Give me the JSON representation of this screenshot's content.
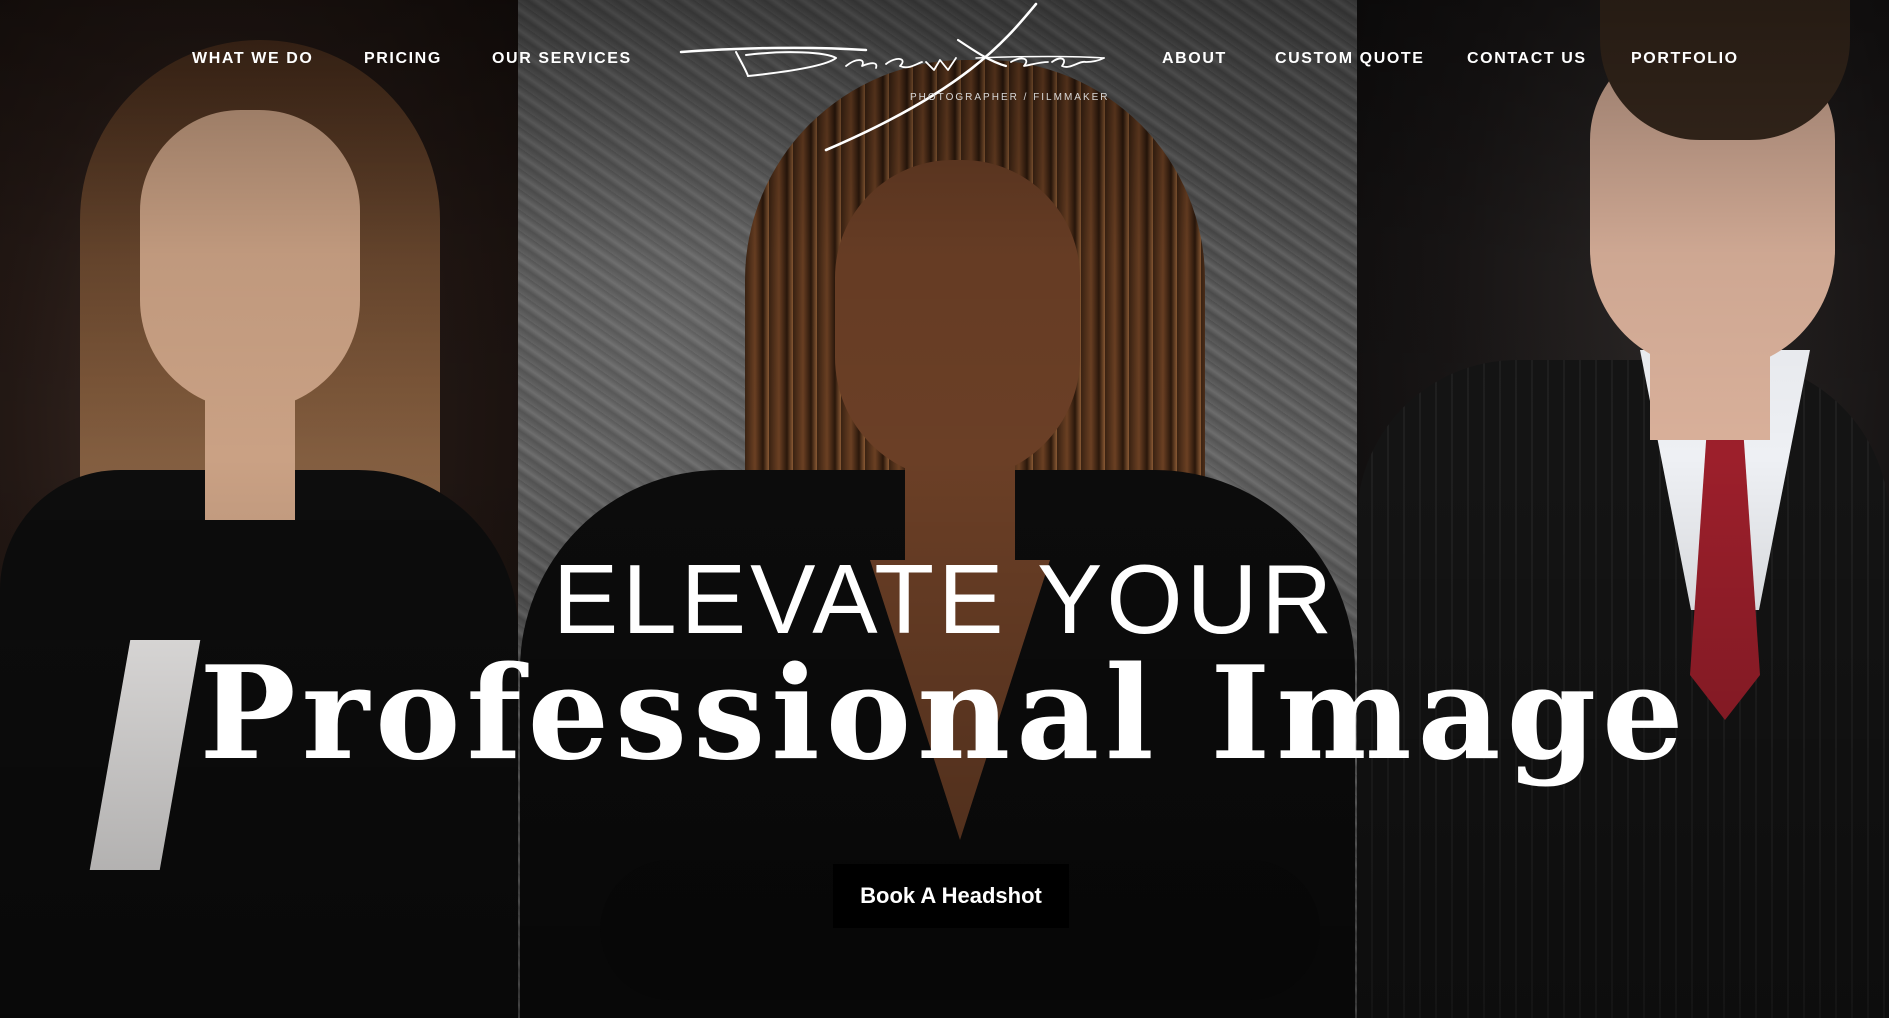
{
  "nav": {
    "left_items": [
      {
        "label": "WHAT WE DO"
      },
      {
        "label": "PRICING"
      },
      {
        "label": "OUR SERVICES"
      }
    ],
    "right_items": [
      {
        "label": "ABOUT"
      },
      {
        "label": "CUSTOM QUOTE"
      },
      {
        "label": "CONTACT US"
      },
      {
        "label": "PORTFOLIO"
      }
    ]
  },
  "logo": {
    "name": "Drew Xeron",
    "tagline": "PHOTOGRAPHER / FILMMAKER"
  },
  "hero": {
    "headline_top": "ELEVATE YOUR",
    "headline_main": "Professional Image",
    "cta_label": "Book A Headshot"
  },
  "colors": {
    "text": "#ffffff",
    "cta_background": "#000000",
    "tie": "#9c1f2b"
  }
}
